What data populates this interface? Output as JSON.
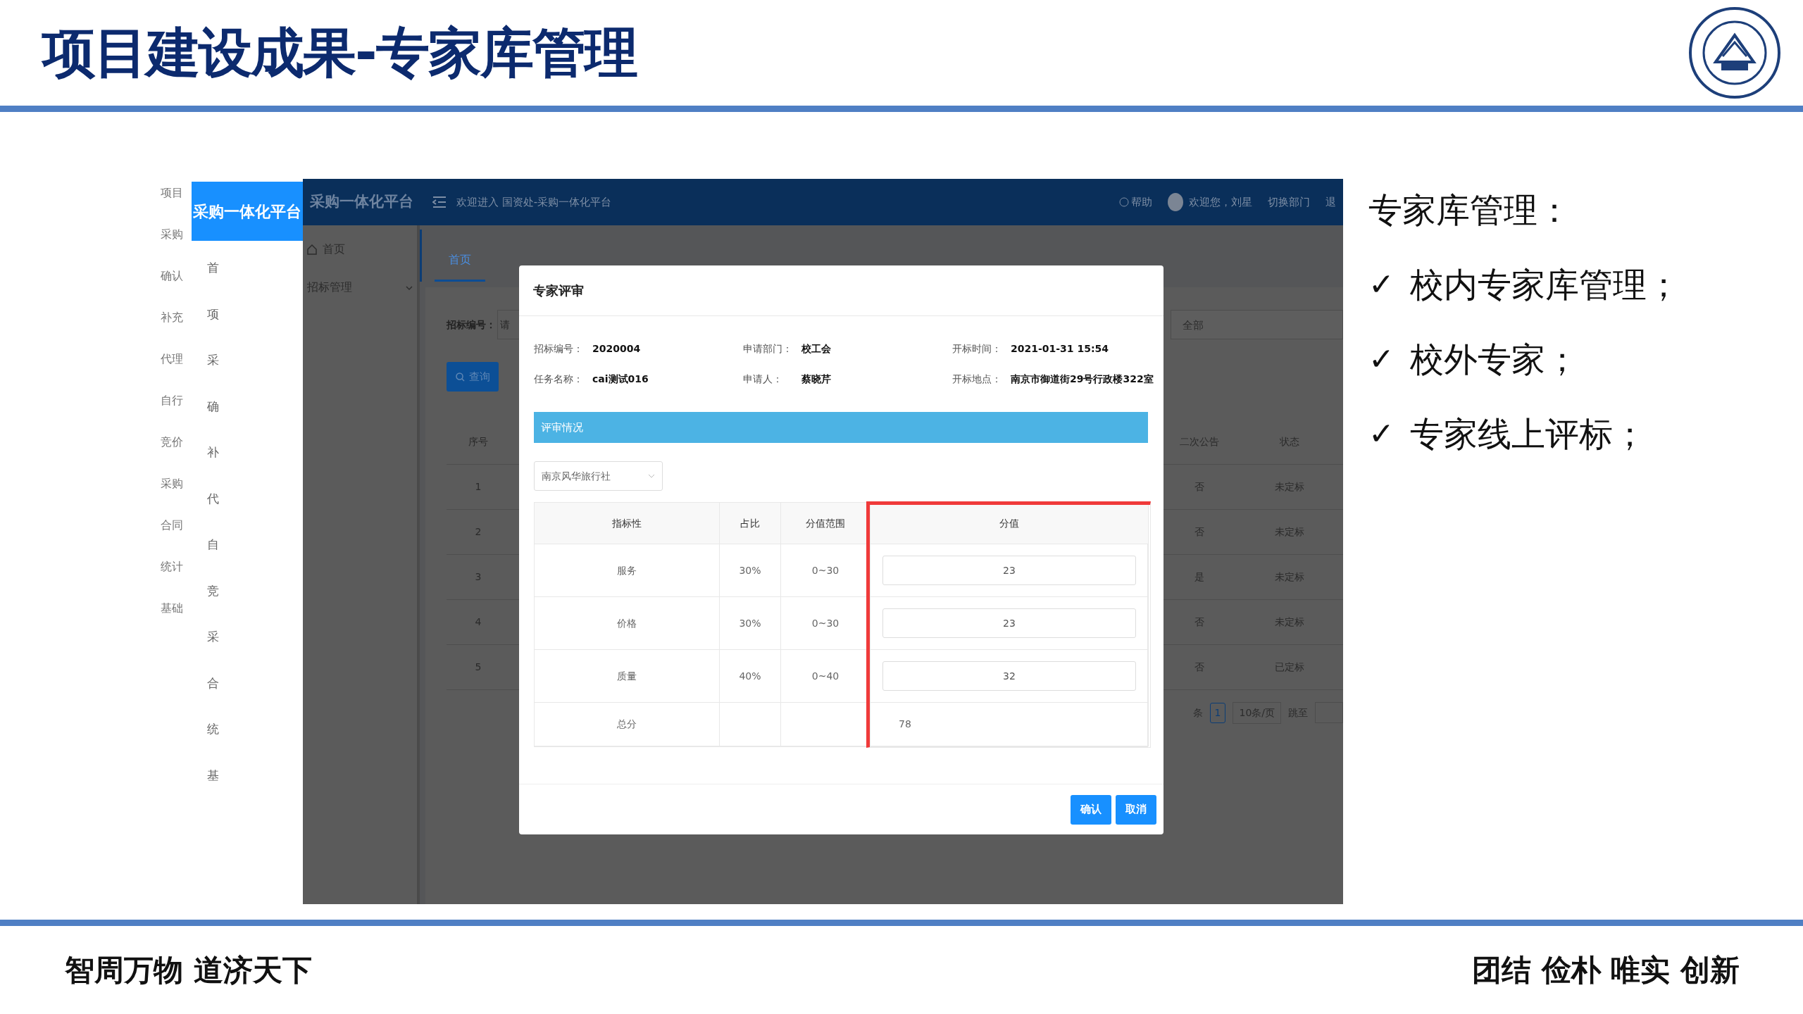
{
  "slide": {
    "title": "项目建设成果-专家库管理",
    "points_heading": "专家库管理：",
    "points": [
      {
        "mark": "✓",
        "text": "校内专家库管理；"
      },
      {
        "mark": "✓",
        "text": "校外专家；"
      },
      {
        "mark": "✓",
        "text": "专家线上评标；"
      }
    ],
    "footer_left": "智周万物 道济天下",
    "footer_right": "团结 俭朴 唯实 创新"
  },
  "app": {
    "outer_menu": [
      "项目",
      "采购",
      "确认",
      "补充",
      "代理",
      "自行",
      "竞价",
      "采购",
      "合同",
      "统计",
      "基础"
    ],
    "inner_menu": {
      "brand": "采购一体化平台",
      "items": [
        "首",
        "项",
        "采",
        "确",
        "补",
        "代",
        "自",
        "竞",
        "采",
        "合",
        "统",
        "基"
      ]
    },
    "navbar": {
      "brand": "采购一体化平台",
      "welcome": "欢迎进入 国资处-采购一体化平台",
      "help": "帮助",
      "user": "欢迎您，刘星",
      "switch": "切换部门",
      "logout": "退"
    },
    "sidebar": [
      {
        "label": "首页",
        "kind": "link"
      },
      {
        "label": "招标管理",
        "kind": "group",
        "expanded": false
      }
    ],
    "tabs": [
      {
        "label": "首页",
        "selected": true
      }
    ],
    "filter": {
      "label": "招标编号：",
      "placeholder": "请",
      "status": "全部"
    },
    "search_button": "查询",
    "table": {
      "columns": [
        "序号",
        "二次公告",
        "状态"
      ],
      "rows": [
        {
          "index": "1",
          "notice": "否",
          "status": "未定标"
        },
        {
          "index": "2",
          "notice": "否",
          "status": "未定标"
        },
        {
          "index": "3",
          "notice": "是",
          "status": "未定标"
        },
        {
          "index": "4",
          "notice": "否",
          "status": "未定标"
        },
        {
          "index": "5",
          "notice": "否",
          "status": "已定标"
        }
      ]
    },
    "pagination": {
      "total": "条",
      "page": "1",
      "page_size": "10条/页",
      "jump": "跳至"
    },
    "dialog": {
      "title": "专家评审",
      "fields": [
        {
          "label": "招标编号：",
          "value": "2020004"
        },
        {
          "label": "申请部门：",
          "value": "校工会"
        },
        {
          "label": "开标时间：",
          "value": "2021-01-31 15:54"
        },
        {
          "label": "任务名称：",
          "value": "cai测试016"
        },
        {
          "label": "申请人：",
          "value": "蔡晓芹"
        },
        {
          "label": "开标地点：",
          "value": "南京市御道街29号行政楼322室"
        }
      ],
      "section": "评审情况",
      "supplier": "南京风华旅行社",
      "score_table": {
        "columns": [
          "指标性",
          "占比",
          "分值范围",
          "分值"
        ],
        "rows": [
          {
            "indicator": "服务",
            "weight": "30%",
            "range": "0~30",
            "score": "23"
          },
          {
            "indicator": "价格",
            "weight": "30%",
            "range": "0~30",
            "score": "23"
          },
          {
            "indicator": "质量",
            "weight": "40%",
            "range": "0~40",
            "score": "32"
          }
        ],
        "total": {
          "label": "总分",
          "value": "78"
        }
      },
      "highlight_score_column": true,
      "buttons": [
        "确认",
        "取消"
      ]
    }
  }
}
